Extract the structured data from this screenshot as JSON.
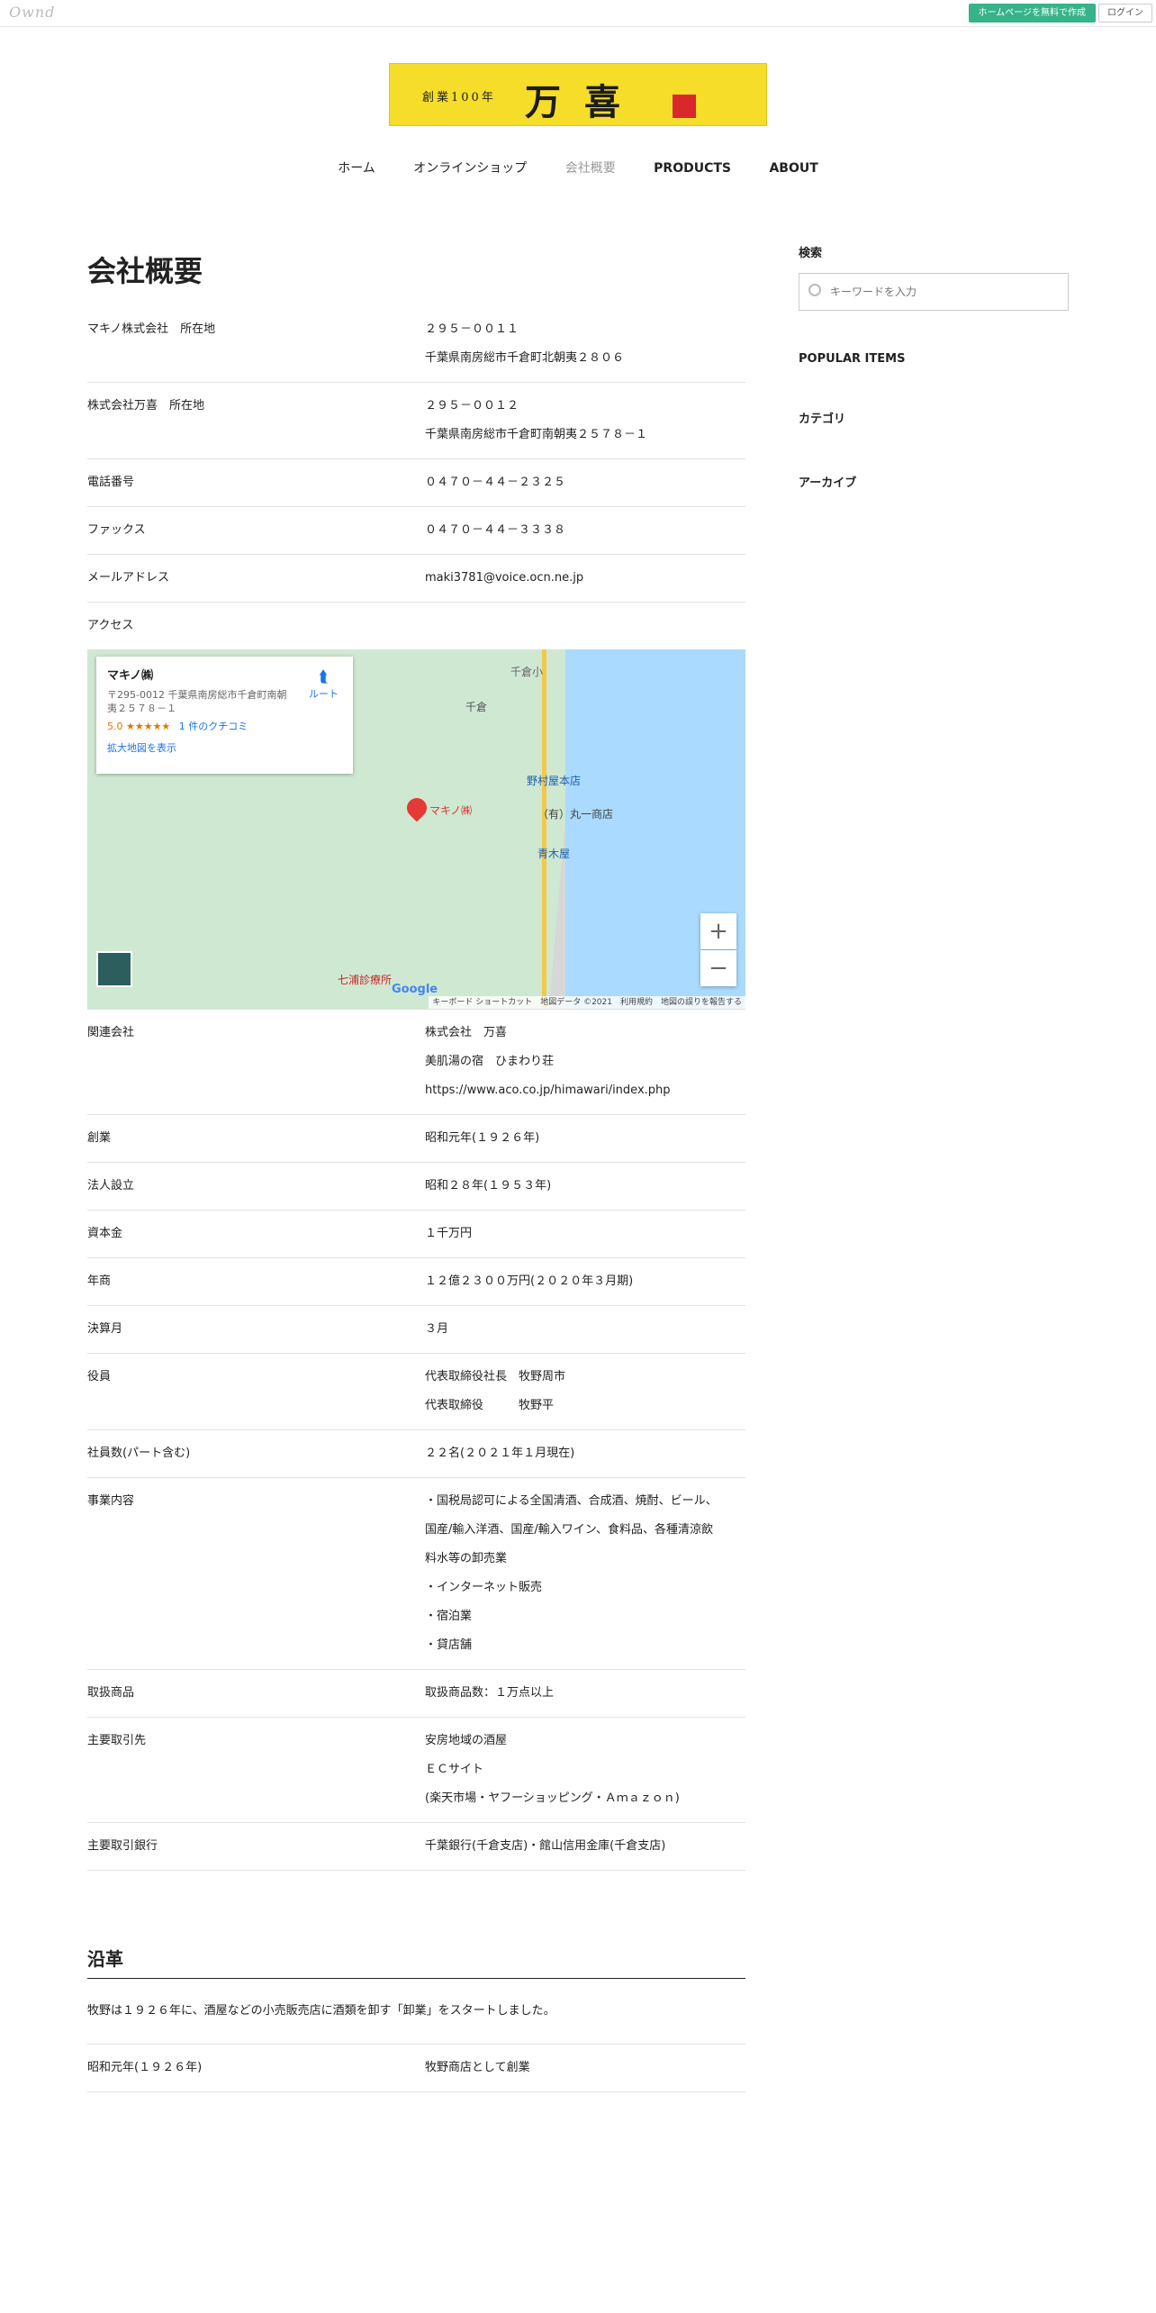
{
  "topbar": {
    "logo": "Ownd",
    "create_label": "ホームページを無料で作成",
    "login_label": "ログイン"
  },
  "banner": {
    "small": "創業100年",
    "big": "万喜"
  },
  "nav": {
    "items": [
      "ホーム",
      "オンラインショップ",
      "会社概要",
      "PRODUCTS",
      "ABOUT"
    ]
  },
  "page": {
    "title": "会社概要"
  },
  "rows": [
    {
      "label": "マキノ株式会社　所在地",
      "lines": [
        "２９５－００１１",
        "千葉県南房総市千倉町北朝夷２８０６"
      ]
    },
    {
      "label": "株式会社万喜　所在地",
      "lines": [
        "２９５－００１２",
        "千葉県南房総市千倉町南朝夷２５７８－１"
      ]
    },
    {
      "label": "電話番号",
      "lines": [
        "０４７０－４４－２３２５"
      ]
    },
    {
      "label": "ファックス",
      "lines": [
        "０４７０－４４－３３３８"
      ]
    },
    {
      "label": "メールアドレス",
      "lines": [
        "maki3781@voice.ocn.ne.jp"
      ]
    },
    {
      "label": "アクセス",
      "lines": []
    }
  ],
  "map": {
    "place_name": "マキノ㈱",
    "address": "〒295-0012 千葉県南房総市千倉町南朝夷２５７８－１",
    "rating": "5.0 ★★★★★",
    "reviews": "1 件のクチコミ",
    "route": "ルート",
    "larger_map": "拡大地図を表示",
    "pin_label": "マキノ㈱",
    "poi1": "野村屋本店",
    "poi2": "（有）丸一商店",
    "poi3": "青木屋",
    "poi4": "七浦診療所",
    "poi5": "千倉",
    "poi6": "千倉小",
    "footer": "キーボード ショートカット　地図データ ©2021　利用規約　地図の誤りを報告する",
    "google": "Google"
  },
  "rows2": [
    {
      "label": "関連会社",
      "lines": [
        "株式会社　万喜",
        "美肌湯の宿　ひまわり荘",
        "https://www.aco.co.jp/himawari/index.php"
      ]
    },
    {
      "label": "創業",
      "lines": [
        "昭和元年(１９２６年)"
      ]
    },
    {
      "label": "法人設立",
      "lines": [
        "昭和２８年(１９５３年)"
      ]
    },
    {
      "label": "資本金",
      "lines": [
        "１千万円"
      ]
    },
    {
      "label": "年商",
      "lines": [
        "１２億２３００万円(２０２０年３月期)"
      ]
    },
    {
      "label": "決算月",
      "lines": [
        "３月"
      ]
    },
    {
      "label": "役員",
      "lines": [
        "代表取締役社長　牧野周市",
        "代表取締役　　　牧野平"
      ]
    },
    {
      "label": "社員数(パート含む)",
      "lines": [
        "２２名(２０２１年１月現在)"
      ]
    },
    {
      "label": "事業内容",
      "lines": [
        "・国税局認可による全国清酒、合成酒、焼酎、ビール、",
        "国産/輸入洋酒、国産/輸入ワイン、食料品、各種清涼飲",
        "料水等の卸売業",
        "・インターネット販売",
        "・宿泊業",
        "・貸店舗"
      ]
    },
    {
      "label": "取扱商品",
      "lines": [
        "取扱商品数：１万点以上"
      ]
    },
    {
      "label": "主要取引先",
      "lines": [
        "安房地域の酒屋",
        "ＥＣサイト",
        "(楽天市場・ヤフーショッピング・Ａｍａｚｏｎ)"
      ]
    },
    {
      "label": "主要取引銀行",
      "lines": [
        "千葉銀行(千倉支店)・館山信用金庫(千倉支店)"
      ]
    }
  ],
  "history": {
    "title": "沿革",
    "intro": "牧野は１９２６年に、酒屋などの小売販売店に酒類を卸す「卸業」をスタートしました。",
    "first_label": "昭和元年(１９２６年)",
    "first_value": "牧野商店として創業"
  },
  "sidebar": {
    "search_title": "検索",
    "search_placeholder": "キーワードを入力",
    "popular": "POPULAR ITEMS",
    "category": "カテゴリ",
    "archive": "アーカイブ"
  }
}
